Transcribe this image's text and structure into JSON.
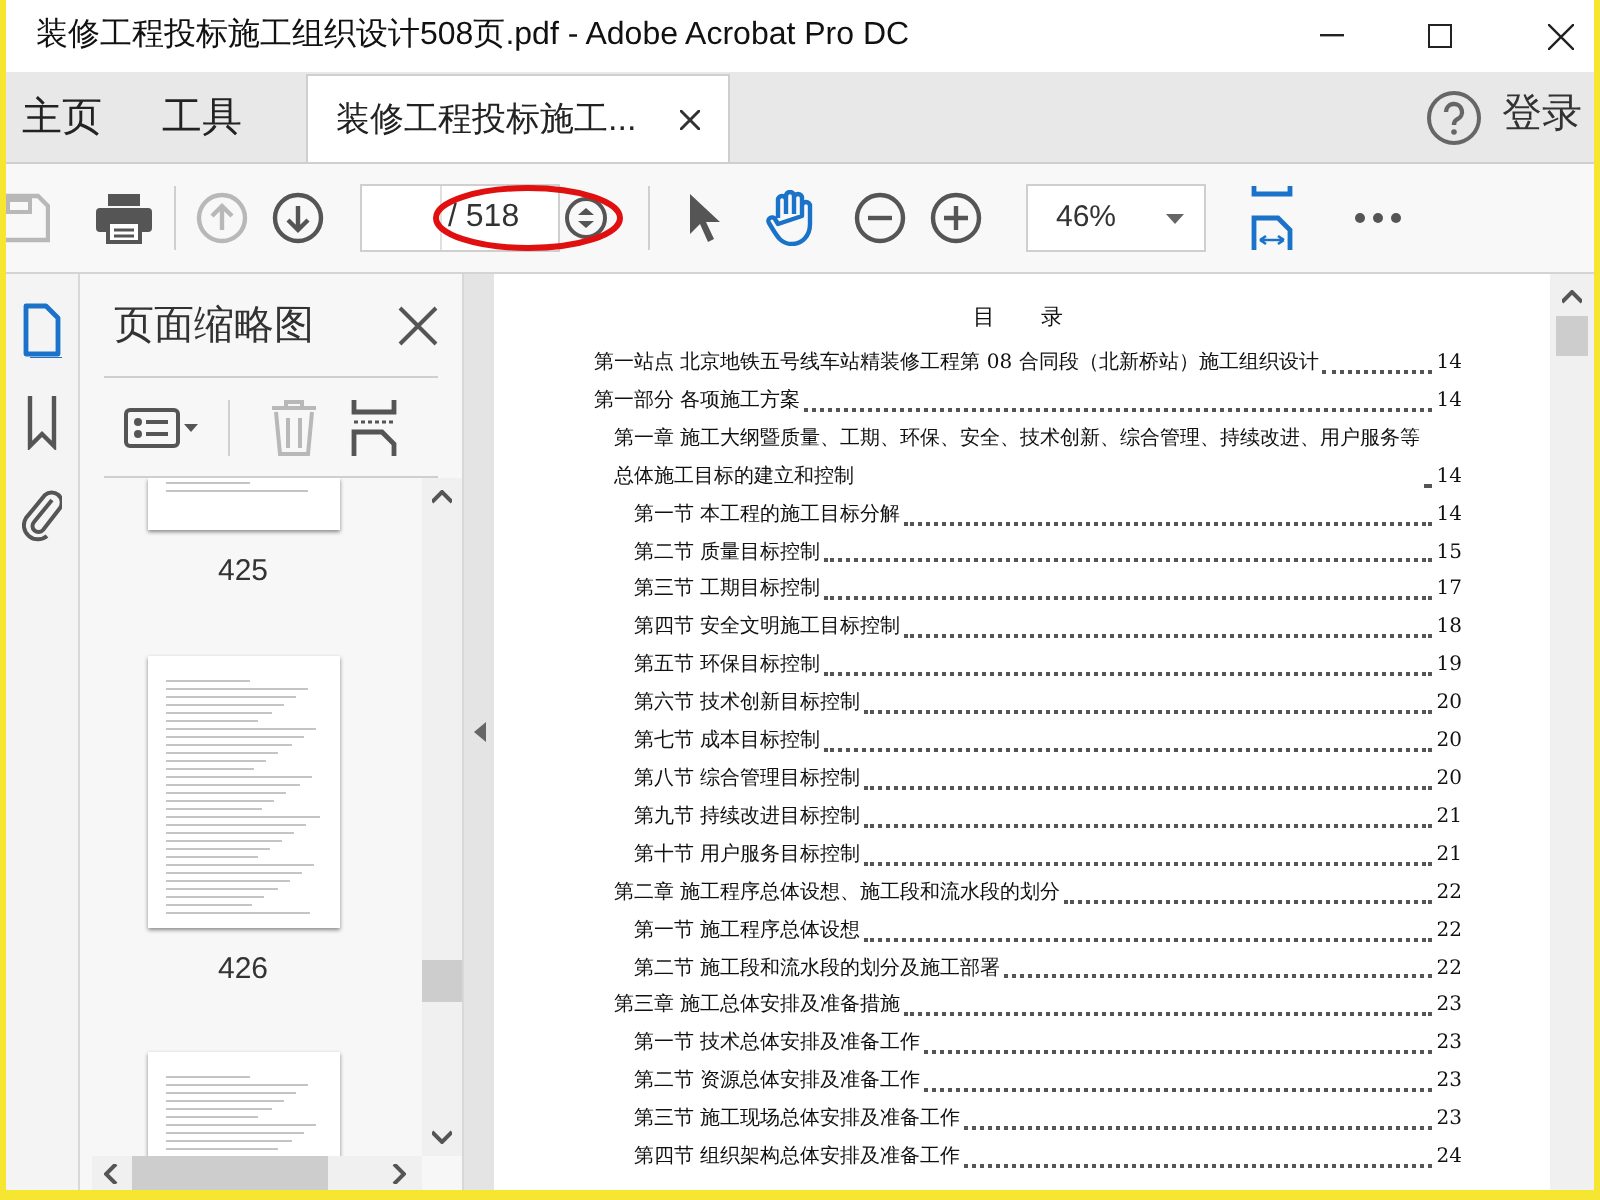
{
  "window": {
    "title": "装修工程投标施工组织设计508页.pdf - Adobe Acrobat Pro DC"
  },
  "tabs": [
    {
      "label": "主页",
      "selected": false,
      "closable": false
    },
    {
      "label": "工具",
      "selected": false,
      "closable": false
    },
    {
      "label": "装修工程投标施工...",
      "selected": true,
      "closable": true
    }
  ],
  "account": {
    "sign_in": "登录"
  },
  "toolbar": {
    "buttons": [
      {
        "kind": "save",
        "disabled": true
      },
      {
        "kind": "print",
        "disabled": false
      },
      {
        "kind": "prev",
        "disabled": true
      },
      {
        "kind": "next",
        "disabled": false
      }
    ],
    "page_total": "/ 518",
    "tools": [
      {
        "kind": "select",
        "selected": false
      },
      {
        "kind": "hand",
        "selected": true
      }
    ],
    "zoom": "46%"
  },
  "sidebar": {
    "rail": [
      {
        "kind": "pages",
        "selected": true
      },
      {
        "kind": "bookmarks",
        "selected": false
      },
      {
        "kind": "attachments",
        "selected": false
      }
    ],
    "title": "页面缩略图",
    "thumbnails": [
      {
        "label": "425"
      },
      {
        "label": "426"
      }
    ]
  },
  "document": {
    "heading": "目 录",
    "toc": [
      {
        "title": "第一站点 北京地铁五号线车站精装修工程第 08 合同段（北新桥站）施工组织设计",
        "page": "14"
      },
      {
        "title": "第一部分 各项施工方案",
        "page": "14",
        "children": [
          {
            "title": "第一章 施工大纲暨质量、工期、环保、安全、技术创新、综合管理、持续改进、用户服务等总体施工目标的建立和控制",
            "page": "14",
            "children": [
              {
                "title": "第一节 本工程的施工目标分解",
                "page": "14"
              },
              {
                "title": "第二节 质量目标控制",
                "page": "15"
              },
              {
                "title": "第三节 工期目标控制",
                "page": "17"
              },
              {
                "title": "第四节 安全文明施工目标控制",
                "page": "18"
              },
              {
                "title": "第五节 环保目标控制",
                "page": "19"
              },
              {
                "title": "第六节 技术创新目标控制",
                "page": "20"
              },
              {
                "title": "第七节 成本目标控制",
                "page": "20"
              },
              {
                "title": "第八节 综合管理目标控制",
                "page": "20"
              },
              {
                "title": "第九节 持续改进目标控制",
                "page": "21"
              },
              {
                "title": "第十节 用户服务目标控制",
                "page": "21"
              }
            ]
          },
          {
            "title": "第二章 施工程序总体设想、施工段和流水段的划分",
            "page": "22",
            "children": [
              {
                "title": "第一节 施工程序总体设想",
                "page": "22"
              },
              {
                "title": "第二节 施工段和流水段的划分及施工部署",
                "page": "22"
              }
            ]
          },
          {
            "title": "第三章 施工总体安排及准备措施",
            "page": "23",
            "children": [
              {
                "title": "第一节 技术总体安排及准备工作",
                "page": "23"
              },
              {
                "title": "第二节 资源总体安排及准备工作",
                "page": "23"
              },
              {
                "title": "第三节 施工现场总体安排及准备工作",
                "page": "23"
              },
              {
                "title": "第四节 组织架构总体安排及准备工作",
                "page": "24"
              }
            ]
          }
        ]
      }
    ]
  }
}
